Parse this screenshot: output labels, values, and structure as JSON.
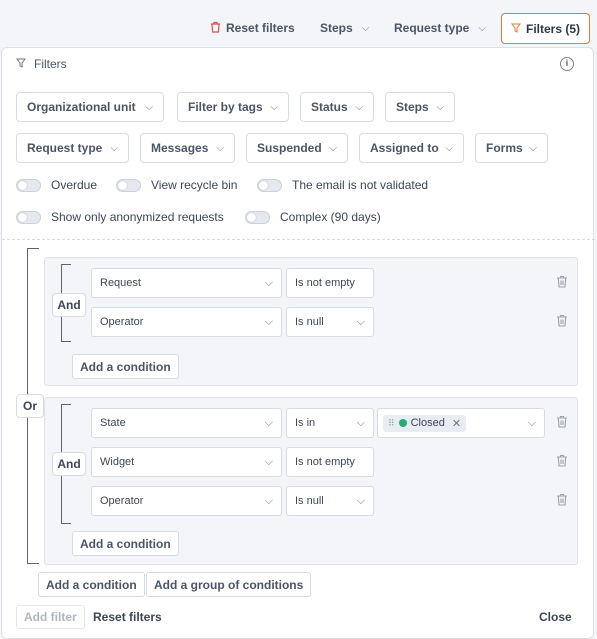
{
  "topbar": {
    "reset_label": "Reset filters",
    "steps_label": "Steps",
    "request_type_label": "Request type",
    "filters_label": "Filters (5)"
  },
  "panel": {
    "title": "Filters",
    "dropdowns": [
      "Organizational unit",
      "Filter by tags",
      "Status",
      "Steps",
      "Request type",
      "Messages",
      "Suspended",
      "Assigned to",
      "Forms"
    ],
    "toggles": [
      "Overdue",
      "View recycle bin",
      "The email is not validated",
      "Show only anonymized requests",
      "Complex (90 days)"
    ]
  },
  "builder": {
    "root_logic": "Or",
    "group1": {
      "logic": "And",
      "conditions": [
        {
          "field": "Request",
          "operator": "Is not empty"
        },
        {
          "field": "Operator",
          "operator": "Is null"
        }
      ],
      "add_label": "Add a condition"
    },
    "group2": {
      "logic": "And",
      "conditions": [
        {
          "field": "State",
          "operator": "Is in",
          "value_chip": "Closed"
        },
        {
          "field": "Widget",
          "operator": "Is not empty"
        },
        {
          "field": "Operator",
          "operator": "Is null"
        }
      ],
      "add_label": "Add a condition"
    },
    "add_condition_label": "Add a condition",
    "add_group_label": "Add a group of conditions"
  },
  "footer": {
    "add_filter_label": "Add filter",
    "reset_label": "Reset filters",
    "close_label": "Close"
  },
  "colors": {
    "accent": "#e07b32",
    "status_closed": "#2aa876"
  }
}
